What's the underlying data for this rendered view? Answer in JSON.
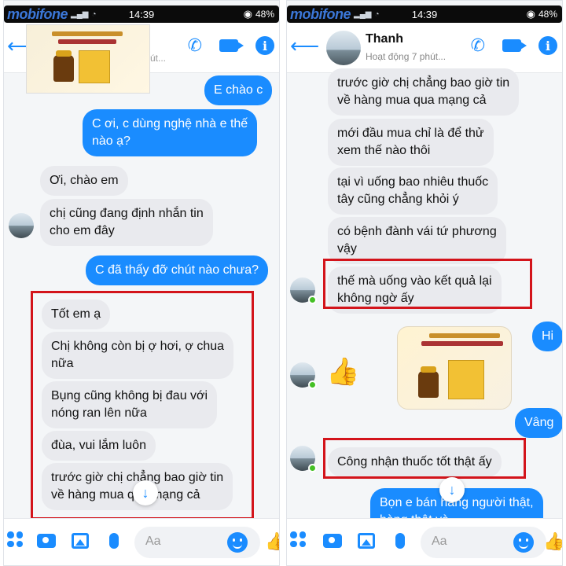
{
  "left": {
    "status": {
      "carrier": "mobifone",
      "time": "14:39",
      "battery": "48%"
    },
    "header": {
      "subtitle": "út..."
    },
    "messages": {
      "m1": "E chào c",
      "m2a": "C ơi, c dùng nghệ nhà e thế",
      "m2b": "nào ạ?",
      "m3": "Ơi, chào em",
      "m4a": "chị cũng đang định nhắn tin",
      "m4b": "cho em đây",
      "m5": "C đã thấy đỡ chút nào chưa?",
      "m6": "Tốt em ạ",
      "m7a": "Chị không còn bị ợ hơi, ợ chua",
      "m7b": "nữa",
      "m8a": "Bụng cũng không bị đau với",
      "m8b": "nóng ran lên nữa",
      "m9": "đùa, vui lắm luôn",
      "m10a": "trước giờ chị chẳng bao giờ tin",
      "m10b": "về hàng mua qua mạng cả"
    },
    "composer": {
      "placeholder": "Aa"
    }
  },
  "right": {
    "status": {
      "carrier": "mobifone",
      "time": "14:39",
      "battery": "48%"
    },
    "header": {
      "name": "Thanh",
      "status": "Hoạt động 7 phút..."
    },
    "messages": {
      "r1a": "trước giờ chị chẳng bao giờ tin",
      "r1b": "về hàng mua qua mạng cả",
      "r2a": "mới đầu mua chỉ là để thử",
      "r2b": "xem thế nào thôi",
      "r3a": "tại vì uống bao nhiêu thuốc",
      "r3b": "tây cũng chẳng khỏi ý",
      "r4a": "có bệnh đành vái tứ phương",
      "r4b": "vậy",
      "r5a": "thế mà uống vào kết quả lại",
      "r5b": "không ngờ ấy",
      "r6": "Hi",
      "r7": "Vâng",
      "r8": "Công nhận thuốc tốt thật ấy",
      "r9a": "Bọn e bán hàng người thật,",
      "r9b": "hàng thật và"
    },
    "composer": {
      "placeholder": "Aa"
    }
  },
  "colors": {
    "accent": "#1a8cff",
    "highlight": "#d3141b",
    "incoming": "#e9eaee"
  },
  "icons": [
    "back-arrow-icon",
    "phone-icon",
    "video-icon",
    "info-icon",
    "apps-icon",
    "camera-icon",
    "image-icon",
    "mic-icon",
    "emoji-icon",
    "like-icon",
    "scroll-down-icon"
  ]
}
